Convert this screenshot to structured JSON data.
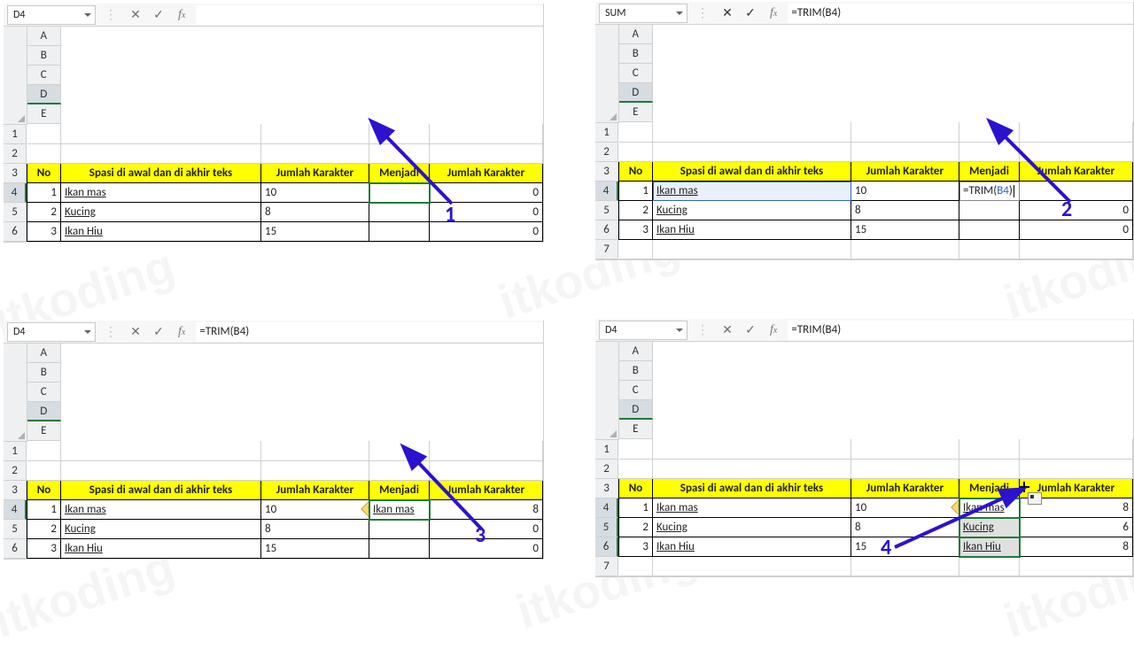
{
  "watermark": "itkoding",
  "headers": {
    "no": "No",
    "spasi": "Spasi di awal dan di akhir teks",
    "jml1": "Jumlah Karakter",
    "menjadi": "Menjadi",
    "jml2": "Jumlah Karakter"
  },
  "rows_src": [
    {
      "no": 1,
      "text": "  Ikan mas",
      "len": "10"
    },
    {
      "no": 2,
      "text": "Kucing ",
      "len": "8"
    },
    {
      "no": 3,
      "text": "   Ikan Hiu  ",
      "len": "15"
    }
  ],
  "panel1": {
    "namebox": "D4",
    "formula": "",
    "menjadi": [
      "",
      "",
      ""
    ],
    "jml2": [
      "0",
      "0",
      "0"
    ]
  },
  "panel2": {
    "namebox": "SUM",
    "formula": "=TRIM(B4)",
    "editing_prefix": "=TRIM(",
    "editing_ref": "B4",
    "editing_suffix": ")",
    "menjadi": [
      "",
      "",
      ""
    ],
    "jml2": [
      "",
      "0",
      "0"
    ]
  },
  "panel3": {
    "namebox": "D4",
    "formula": "=TRIM(B4)",
    "menjadi": [
      "Ikan mas",
      "",
      ""
    ],
    "jml2": [
      "8",
      "0",
      "0"
    ]
  },
  "panel4": {
    "namebox": "D4",
    "formula": "=TRIM(B4)",
    "menjadi": [
      "Ikan mas",
      "Kucing",
      "Ikan Hiu"
    ],
    "jml2": [
      "8",
      "6",
      "8"
    ]
  },
  "step_labels": {
    "s1": "1",
    "s2": "2",
    "s3": "3",
    "s4": "4"
  },
  "columns": [
    "A",
    "B",
    "C",
    "D",
    "E"
  ]
}
